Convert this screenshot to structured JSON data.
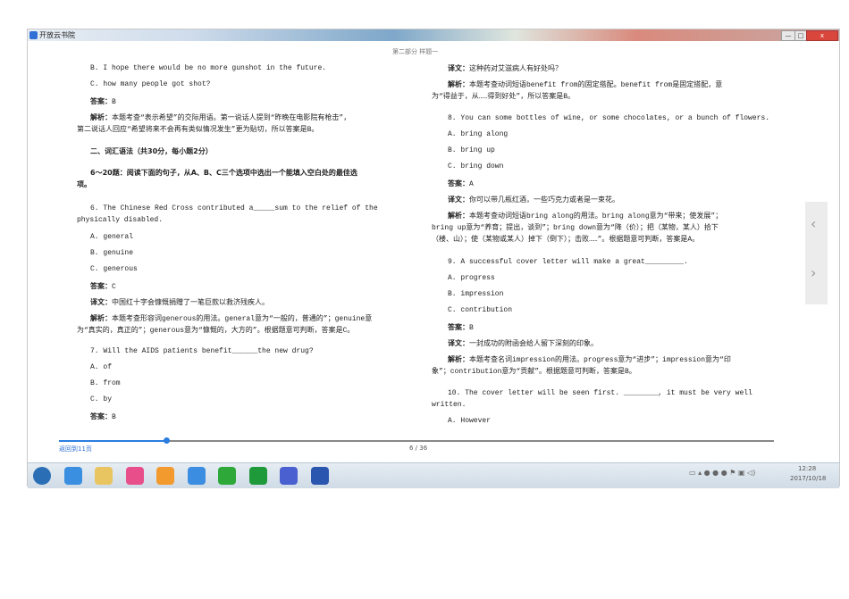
{
  "window": {
    "title": "开放云书院",
    "minimize": "—",
    "maximize": "□",
    "close": "x"
  },
  "header": "第二部分  样题一",
  "left_lines": [
    {
      "text": "B. I hope there would be no more gunshot in the future."
    },
    {
      "text": "C. how many people got shot?"
    },
    {
      "label": "答案：",
      "text": "B"
    },
    {
      "label": "解析：",
      "text": "本题考查“表示希望”的交际用语。第一说话人提到“昨晚在电影院有枪击”，"
    },
    {
      "text": "第二说话人回应“希望将来不会再有类似情况发生”更为贴切，所以答案是B。"
    },
    {
      "heading": "二、词汇语法（共30分，每小题2分）"
    },
    {
      "heading": "6～20题：阅读下面的句子，从A、B、C三个选项中选出一个能填入空白处的最佳选"
    },
    {
      "heading": "项。"
    },
    {
      "text": "6. The Chinese Red Cross contributed a_____sum to the relief of the"
    },
    {
      "text": "physically disabled."
    },
    {
      "text": "A. general"
    },
    {
      "text": "B. genuine"
    },
    {
      "text": "C. generous"
    },
    {
      "label": "答案：",
      "text": "C"
    },
    {
      "label": "译文：",
      "text": "中国红十字会慷慨捐赠了一笔巨款以救济残疾人。"
    },
    {
      "label": "解析：",
      "text": "本题考查形容词generous的用法。general意为“一般的，普通的”；genuine意"
    },
    {
      "text": "为“真实的，真正的”；generous意为“慷慨的，大方的”。根据题意可判断，答案是C。"
    },
    {
      "text": "7. Will the AIDS patients benefit______the new drug?"
    },
    {
      "text": "A. of"
    },
    {
      "text": "B. from"
    },
    {
      "text": "C. by"
    },
    {
      "label": "答案：",
      "text": "B"
    }
  ],
  "right_lines": [
    {
      "label": "译文：",
      "text": "这种药对艾滋病人有好处吗？"
    },
    {
      "label": "解析：",
      "text": "本题考查动词短语benefit from的固定搭配。benefit from是固定搭配，意"
    },
    {
      "text": "为“得益于，从……得到好处”，所以答案是B。"
    },
    {
      "text": "8. You can some bottles of wine, or some chocolates, or a bunch of flowers."
    },
    {
      "text": "A. bring along"
    },
    {
      "text": "B. bring up"
    },
    {
      "text": "C. bring down"
    },
    {
      "label": "答案：",
      "text": "A"
    },
    {
      "label": "译文：",
      "text": "你可以带几瓶红酒，一些巧克力或者是一束花。"
    },
    {
      "label": "解析：",
      "text": "本题考查动词短语bring along的用法。bring along意为“带来；使发展”；"
    },
    {
      "text": "bring up意为“养育；提出，谈到”；bring down意为“降（价）；把（某物，某人）拾下"
    },
    {
      "text": "（楼、山）；使（某物或某人）掉下（倒下）；击败……”。根据题意可判断，答案是A。"
    },
    {
      "text": "9. A successful cover letter will make a great_________."
    },
    {
      "text": "A. progress"
    },
    {
      "text": "B. impression"
    },
    {
      "text": "C. contribution"
    },
    {
      "label": "答案：",
      "text": "B"
    },
    {
      "label": "译文：",
      "text": "一封成功的附函会给人留下深刻的印象。"
    },
    {
      "label": "解析：",
      "text": "本题考查名词impression的用法。progress意为“进步”；impression意为“印"
    },
    {
      "text": "象”；contribution意为“贡献”。根据题意可判断，答案是B。"
    },
    {
      "text": "10. The cover letter will be seen first. ________, it must be very well"
    },
    {
      "text": "written."
    },
    {
      "text": "A. However"
    }
  ],
  "footer": {
    "back_link": "返回到11页",
    "page_indicator": "6 / 36",
    "progress_percent": 15
  },
  "side_nav": {
    "prev": "‹",
    "next": "›"
  },
  "taskbar": {
    "icons": [
      "start-orb",
      "ie-browser",
      "file-explorer",
      "photo-app",
      "pinwheel-app",
      "qq-browser",
      "iqiyi",
      "green-app",
      "reader-app",
      "word"
    ],
    "time": "12:28",
    "date": "2017/10/18"
  }
}
